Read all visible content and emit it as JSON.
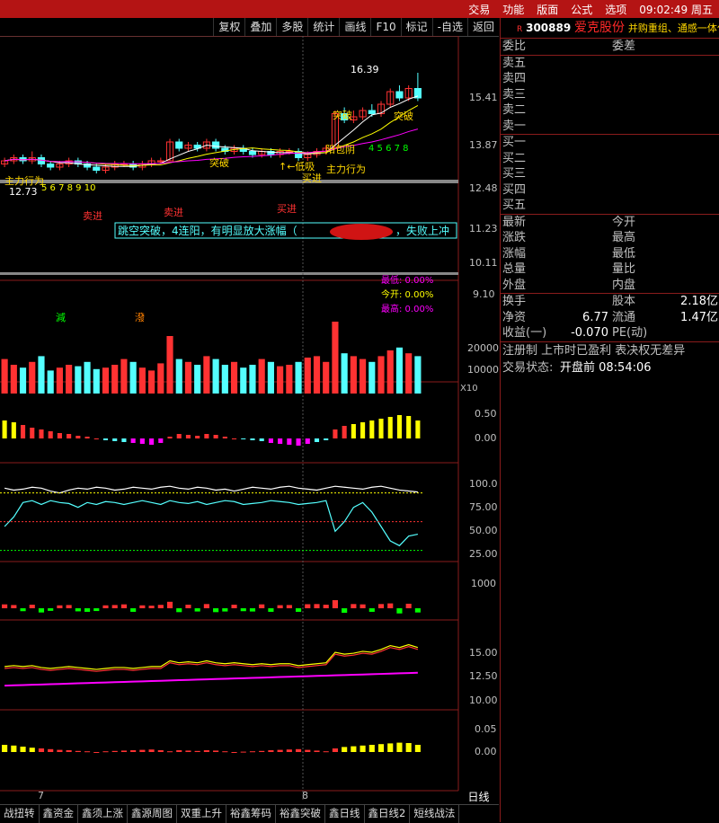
{
  "top_menu": [
    "交易",
    "功能",
    "版面",
    "公式",
    "选项"
  ],
  "clock": "09:02:49 周五",
  "toolbar": [
    "复权",
    "叠加",
    "多股",
    "统计",
    "画线",
    "F10",
    "标记",
    "-自选",
    "返回"
  ],
  "stock": {
    "code": "300889",
    "name": "爱克股份",
    "concept": "并购重组、通感一体化"
  },
  "order_book": {
    "title": "委比",
    "diff_label": "委差",
    "sell": [
      "卖五",
      "卖四",
      "卖三",
      "卖二",
      "卖一"
    ],
    "buy": [
      "买一",
      "买二",
      "买三",
      "买四",
      "买五"
    ]
  },
  "quote_rows": [
    [
      "最新",
      "今开"
    ],
    [
      "涨跌",
      "最高"
    ],
    [
      "涨幅",
      "最低"
    ],
    [
      "总量",
      "量比"
    ],
    [
      "外盘",
      "内盘"
    ]
  ],
  "fundamentals": [
    {
      "l1": "换手",
      "v1": "",
      "l2": "股本",
      "v2": "2.18亿"
    },
    {
      "l1": "净资",
      "v1": "6.77",
      "l2": "流通",
      "v2": "1.47亿"
    },
    {
      "l1": "收益(一)",
      "v1": "-0.070",
      "l2": "PE(动)",
      "v2": ""
    }
  ],
  "notes": [
    "注册制 上市时已盈利 表决权无差异"
  ],
  "trade_status": {
    "label": "交易状态:",
    "value": "开盘前 08:54:06"
  },
  "bottom_tabs": [
    "战扭转",
    "鑫资金",
    "鑫须上涨",
    "鑫源周图",
    "双重上升",
    "裕鑫筹码",
    "裕鑫突破",
    "鑫日线",
    "鑫日线2",
    "短线战法"
  ],
  "period": "日线",
  "date_labels": [
    "7",
    "8"
  ],
  "price_axis": [
    "15.41",
    "13.87",
    "12.48",
    "11.23",
    "10.11",
    "9.10"
  ],
  "price_annotations": {
    "high": "16.39",
    "low": "12.73",
    "banner": "跳空突破，4连阳，有明显放大涨幅（",
    "banner2": "，失败上冲",
    "stats": [
      "最低: 0.00%",
      "今开: 0.00%",
      "最高: 0.00%"
    ],
    "signals": [
      "主力行为",
      "主力行为",
      "↑←低吸",
      "阳包阴",
      "买进",
      "买进",
      "卖进",
      "卖进",
      "突破",
      "突破",
      "突破"
    ],
    "count_a": "5 6 7 8 9 10",
    "count_b": "4 5 6 7 8",
    "marks": [
      "減",
      "潑"
    ]
  },
  "vol_axis": [
    "20000",
    "10000"
  ],
  "vol_unit": "X10",
  "macd_axis": [
    "0.50",
    "0.00"
  ],
  "kdj_axis": [
    "100.0",
    "75.00",
    "50.00",
    "25.00"
  ],
  "ind4_axis": [
    "1000"
  ],
  "ind5_axis": [
    "15.00",
    "12.50",
    "10.00"
  ],
  "ind6_axis": [
    "0.05",
    "0.00"
  ],
  "colors": {
    "up": "#ff3232",
    "down": "#54ffff",
    "yellow": "#ffff00",
    "magenta": "#ff00ff",
    "gold": "#ffd700"
  },
  "chart_data": {
    "type": "candlestick",
    "candles": [
      [
        13.5,
        13.7,
        13.4,
        13.6
      ],
      [
        13.6,
        13.8,
        13.5,
        13.7
      ],
      [
        13.7,
        13.8,
        13.5,
        13.6
      ],
      [
        13.6,
        13.9,
        13.5,
        13.7
      ],
      [
        13.7,
        13.8,
        13.4,
        13.5
      ],
      [
        13.5,
        13.6,
        13.3,
        13.4
      ],
      [
        13.4,
        13.6,
        13.3,
        13.5
      ],
      [
        13.5,
        13.7,
        13.4,
        13.6
      ],
      [
        13.6,
        13.7,
        13.4,
        13.5
      ],
      [
        13.5,
        13.6,
        13.3,
        13.4
      ],
      [
        13.4,
        13.5,
        13.2,
        13.3
      ],
      [
        13.3,
        13.5,
        13.2,
        13.4
      ],
      [
        13.4,
        13.6,
        13.3,
        13.5
      ],
      [
        13.5,
        13.6,
        13.4,
        13.5
      ],
      [
        13.5,
        13.6,
        13.3,
        13.4
      ],
      [
        13.4,
        13.6,
        13.3,
        13.5
      ],
      [
        13.5,
        13.7,
        13.4,
        13.6
      ],
      [
        13.6,
        13.7,
        13.5,
        13.6
      ],
      [
        13.6,
        14.3,
        13.6,
        14.2
      ],
      [
        14.2,
        14.3,
        13.9,
        14.0
      ],
      [
        14.0,
        14.2,
        13.9,
        14.1
      ],
      [
        14.1,
        14.2,
        13.9,
        14.0
      ],
      [
        14.0,
        14.3,
        13.9,
        14.2
      ],
      [
        14.2,
        14.3,
        13.9,
        14.0
      ],
      [
        14.0,
        14.1,
        13.8,
        13.9
      ],
      [
        13.9,
        14.1,
        13.8,
        14.0
      ],
      [
        14.0,
        14.1,
        13.8,
        13.9
      ],
      [
        13.9,
        14.0,
        13.7,
        13.8
      ],
      [
        13.8,
        14.0,
        13.7,
        13.9
      ],
      [
        13.9,
        14.0,
        13.7,
        13.8
      ],
      [
        13.8,
        14.0,
        13.7,
        13.9
      ],
      [
        13.9,
        14.0,
        13.8,
        13.9
      ],
      [
        13.9,
        14.0,
        13.6,
        13.7
      ],
      [
        13.7,
        13.9,
        13.6,
        13.8
      ],
      [
        13.8,
        14.0,
        13.7,
        13.9
      ],
      [
        13.9,
        14.1,
        13.8,
        14.0
      ],
      [
        14.0,
        15.2,
        14.0,
        15.1
      ],
      [
        15.1,
        15.3,
        14.8,
        14.9
      ],
      [
        14.9,
        15.2,
        14.8,
        15.0
      ],
      [
        15.0,
        15.3,
        14.9,
        15.2
      ],
      [
        15.2,
        15.4,
        15.0,
        15.1
      ],
      [
        15.1,
        15.5,
        15.0,
        15.4
      ],
      [
        15.4,
        15.9,
        15.3,
        15.8
      ],
      [
        15.8,
        16.0,
        15.5,
        15.6
      ],
      [
        15.6,
        16.0,
        15.5,
        15.9
      ],
      [
        15.9,
        16.4,
        15.5,
        15.6
      ]
    ],
    "volume": [
      12000,
      10000,
      9000,
      11000,
      13000,
      8000,
      9000,
      10000,
      9500,
      11000,
      8500,
      9000,
      10000,
      12000,
      11000,
      9000,
      8000,
      10500,
      20000,
      12000,
      11000,
      10000,
      13000,
      12000,
      10000,
      11000,
      9000,
      10000,
      12000,
      11000,
      9500,
      10000,
      11000,
      12500,
      13000,
      11000,
      25000,
      14000,
      13000,
      12000,
      11000,
      13000,
      15000,
      16000,
      14000,
      13000
    ],
    "macd": [
      0.2,
      0.18,
      0.15,
      0.12,
      0.1,
      0.08,
      0.06,
      0.05,
      0.03,
      0.02,
      0.0,
      -0.02,
      -0.03,
      -0.04,
      -0.05,
      -0.06,
      -0.07,
      -0.05,
      0.02,
      0.05,
      0.04,
      0.03,
      0.05,
      0.04,
      0.02,
      0.0,
      -0.01,
      -0.02,
      -0.03,
      -0.05,
      -0.06,
      -0.07,
      -0.08,
      -0.06,
      -0.04,
      -0.02,
      0.1,
      0.14,
      0.16,
      0.18,
      0.2,
      0.22,
      0.24,
      0.26,
      0.25,
      0.2
    ],
    "kdj_white": [
      95,
      93,
      94,
      96,
      95,
      92,
      90,
      93,
      95,
      94,
      96,
      95,
      93,
      94,
      96,
      95,
      94,
      96,
      97,
      95,
      94,
      96,
      95,
      93,
      94,
      92,
      94,
      96,
      95,
      94,
      96,
      97,
      95,
      94,
      93,
      95,
      97,
      96,
      95,
      94,
      96,
      97,
      95,
      93,
      92,
      91
    ],
    "kdj_cyan": [
      55,
      65,
      80,
      82,
      78,
      82,
      80,
      79,
      75,
      80,
      78,
      81,
      80,
      78,
      80,
      82,
      80,
      78,
      82,
      80,
      79,
      81,
      78,
      80,
      82,
      81,
      78,
      79,
      80,
      82,
      81,
      80,
      78,
      79,
      80,
      82,
      50,
      60,
      75,
      80,
      70,
      55,
      40,
      35,
      45,
      47
    ]
  }
}
